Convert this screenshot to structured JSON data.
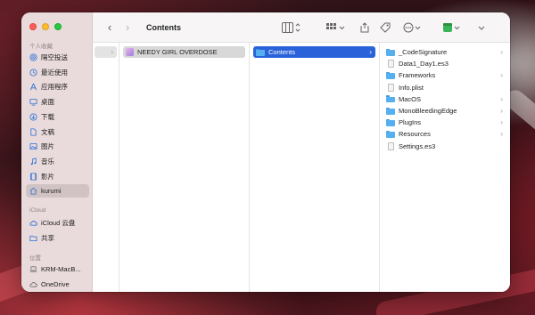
{
  "window": {
    "title": "Contents"
  },
  "sidebar": {
    "sections": {
      "favorites": "个人收藏",
      "icloud": "iCloud",
      "locations": "位置"
    },
    "favorites": [
      {
        "label": "隔空投送",
        "icon": "airdrop-icon"
      },
      {
        "label": "最近使用",
        "icon": "clock-icon"
      },
      {
        "label": "应用程序",
        "icon": "applications-icon"
      },
      {
        "label": "桌面",
        "icon": "desktop-icon"
      },
      {
        "label": "下载",
        "icon": "download-icon"
      },
      {
        "label": "文稿",
        "icon": "document-icon"
      },
      {
        "label": "图片",
        "icon": "photo-icon"
      },
      {
        "label": "音乐",
        "icon": "music-icon"
      },
      {
        "label": "影片",
        "icon": "film-icon"
      },
      {
        "label": "kurumi",
        "icon": "home-icon",
        "active": true
      }
    ],
    "icloud": [
      {
        "label": "iCloud 云盘",
        "icon": "cloud-icon"
      },
      {
        "label": "共享",
        "icon": "shared-folder-icon"
      }
    ],
    "locations": [
      {
        "label": "KRM-MacB...",
        "icon": "laptop-icon"
      },
      {
        "label": "OneDrive",
        "icon": "cloud-icon"
      }
    ]
  },
  "columns": {
    "col2": [
      {
        "label": "NEEDY GIRL OVERDOSE",
        "kind": "app"
      }
    ],
    "col3": [
      {
        "label": "Contents",
        "kind": "folder"
      }
    ],
    "col4": [
      {
        "label": "_CodeSignature",
        "kind": "folder",
        "chevron": true
      },
      {
        "label": "Data1_Day1.es3",
        "kind": "file",
        "chevron": false
      },
      {
        "label": "Frameworks",
        "kind": "folder",
        "chevron": true
      },
      {
        "label": "Info.plist",
        "kind": "file",
        "chevron": false
      },
      {
        "label": "MacOS",
        "kind": "folder",
        "chevron": true
      },
      {
        "label": "MonoBleedingEdge",
        "kind": "folder",
        "chevron": true
      },
      {
        "label": "PlugIns",
        "kind": "folder",
        "chevron": true
      },
      {
        "label": "Resources",
        "kind": "folder",
        "chevron": true
      },
      {
        "label": "Settings.es3",
        "kind": "file",
        "chevron": false
      }
    ]
  },
  "glyphs": {
    "back": "‹",
    "forward": "›",
    "chevron": "›"
  },
  "colors": {
    "accent": "#2a63d9",
    "folder": "#56b0f0",
    "close": "#fe5f57",
    "minimize": "#febc2e",
    "maximize": "#28c840"
  }
}
